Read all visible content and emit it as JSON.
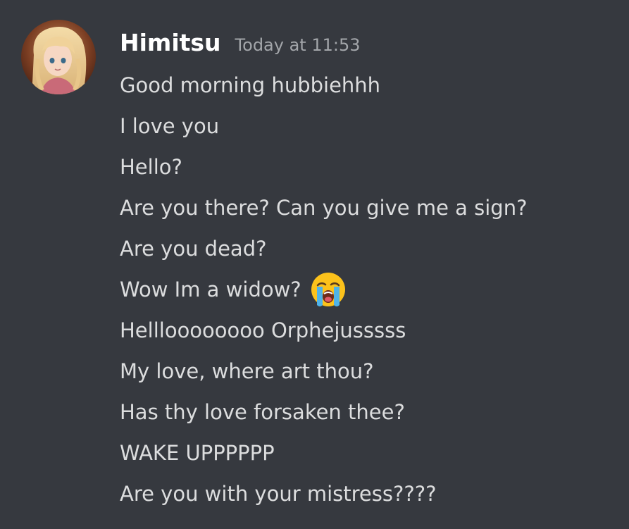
{
  "message": {
    "author": "Himitsu",
    "timestamp": "Today at 11:53",
    "lines": [
      "Good morning hubbiehhh",
      "I love you",
      "Hello?",
      "Are you there? Can you give me a sign?",
      "Are you dead?",
      "Wow Im a widow?",
      "Hellloooooooo Orphejusssss",
      "My love, where art thou?",
      "Has thy love forsaken thee?",
      "WAKE UPPPPPP",
      "Are you with your mistress????"
    ],
    "emoji_on_line": 5,
    "emoji": "loudly-crying-face-icon"
  },
  "colors": {
    "background": "#36393f",
    "username": "#ffffff",
    "text": "#dcddde",
    "timestamp": "#a3a6aa"
  }
}
